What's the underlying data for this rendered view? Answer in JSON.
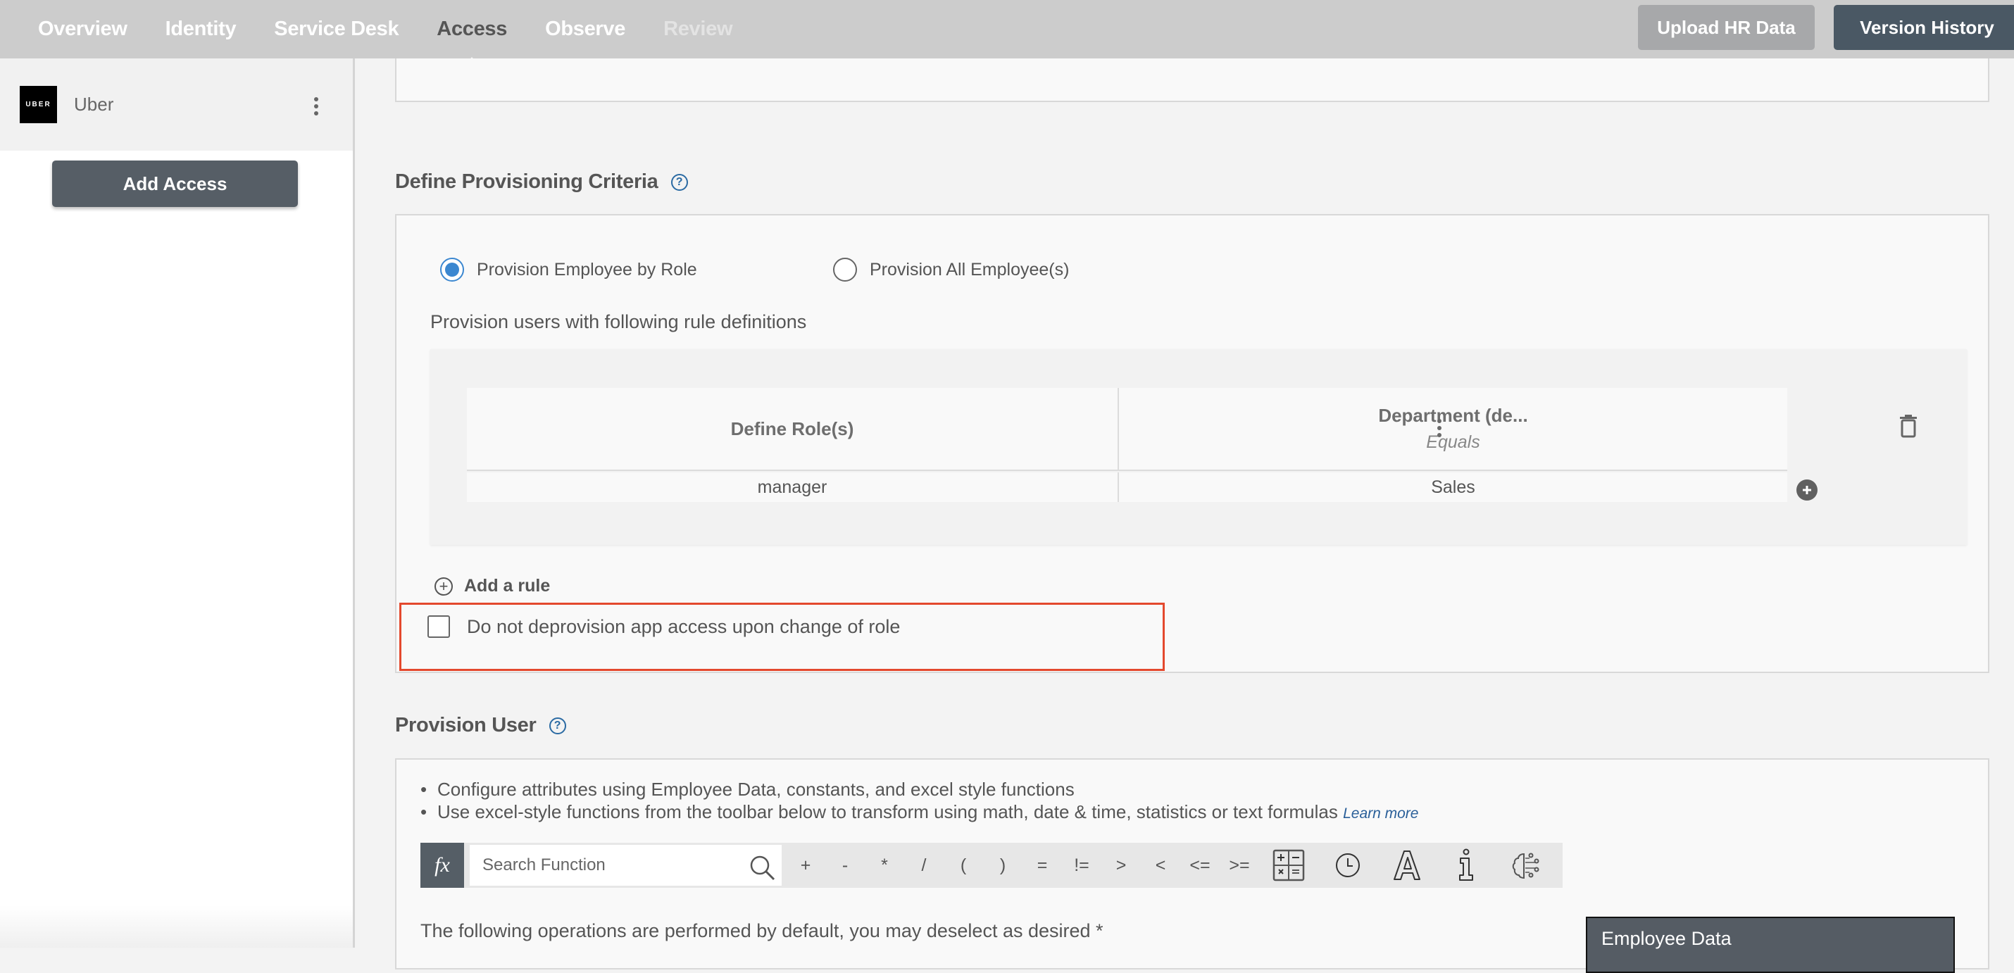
{
  "nav": {
    "tabs": [
      {
        "label": "Overview",
        "state": "normal"
      },
      {
        "label": "Identity",
        "state": "normal"
      },
      {
        "label": "Service Desk",
        "state": "normal"
      },
      {
        "label": "Access",
        "state": "active"
      },
      {
        "label": "Observe",
        "state": "normal"
      },
      {
        "label": "Review",
        "state": "disabled"
      }
    ],
    "upload_button": "Upload HR Data",
    "version_button": "Version History"
  },
  "sidebar": {
    "app_logo_text": "UBER",
    "app_name": "Uber",
    "add_access_button": "Add Access"
  },
  "criteria": {
    "title": "Define Provisioning Criteria",
    "help_glyph": "?",
    "radio_options": [
      {
        "label": "Provision Employee by Role",
        "checked": true
      },
      {
        "label": "Provision All Employee(s)",
        "checked": false
      }
    ],
    "rule_description": "Provision users with following rule definitions",
    "table": {
      "columns": [
        {
          "title": "Define Role(s)",
          "subtitle": ""
        },
        {
          "title": "Department (de...",
          "subtitle": "Equals"
        }
      ],
      "rows": [
        [
          "manager",
          "Sales"
        ]
      ]
    },
    "add_rule_label": "Add a rule",
    "add_rule_glyph": "+",
    "checkbox_label": "Do not deprovision app access upon change of role",
    "checkbox_checked": false,
    "highlight_color": "#e4492e"
  },
  "provision_user": {
    "title": "Provision User",
    "help_glyph": "?",
    "bullets": [
      "Configure attributes using Employee Data, constants, and excel style functions",
      "Use excel-style functions from the toolbar below to transform using math, date & time, statistics or text formulas"
    ],
    "learn_more": "Learn more",
    "toolbar": {
      "fx_label": "fx",
      "search_placeholder": "Search Function",
      "operators": [
        "+",
        "-",
        "*",
        "/",
        "(",
        ")",
        "=",
        "!=",
        ">",
        "<",
        "<=",
        ">="
      ],
      "icons": [
        "math-functions-icon",
        "date-time-icon",
        "text-functions-icon",
        "info-functions-icon",
        "ai-brain-icon"
      ]
    },
    "ops_note": "The following operations are performed by default, you may deselect as desired *",
    "employee_data_header": "Employee Data"
  }
}
